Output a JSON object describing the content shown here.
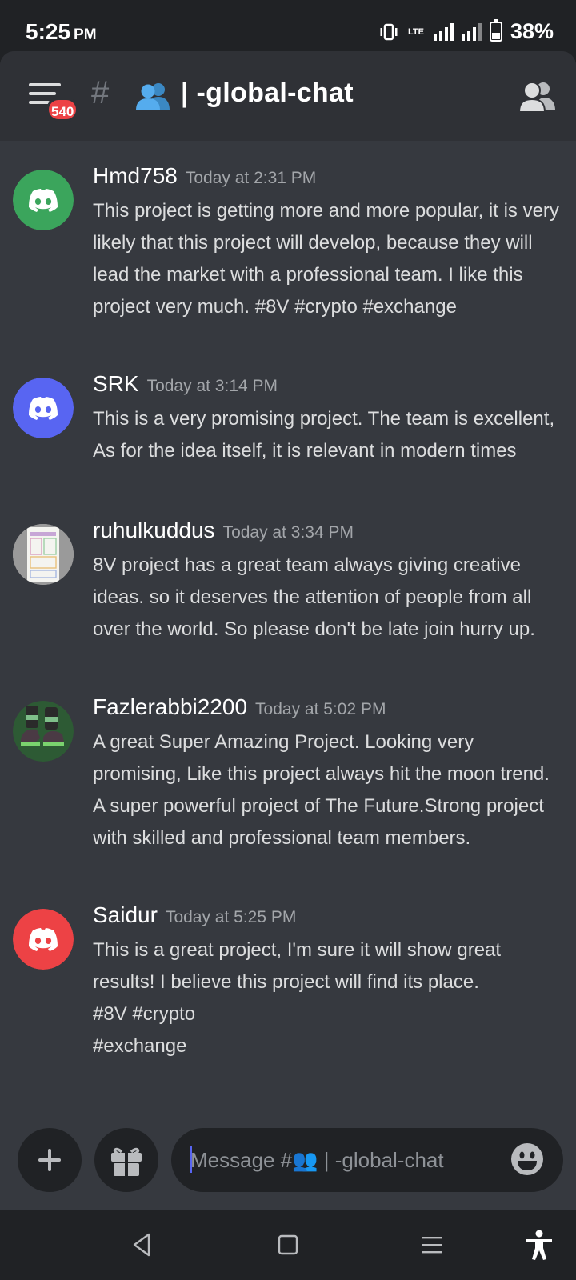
{
  "status_bar": {
    "time": "5:25",
    "ampm": "PM",
    "network": "LTE",
    "battery": "38%",
    "battery_level": 0.38
  },
  "header": {
    "unread_badge": "540",
    "channel_prefix": "#",
    "channel_emoji": "people-emoji",
    "channel_name": "| -global-chat"
  },
  "messages": [
    {
      "author": "Hmd758",
      "time": "Today at 2:31 PM",
      "avatar_color": "#3ba55c",
      "text": "This project is getting more and more popular, it is very likely that this project will develop, because they will lead the market with a professional team. I like this project very much. #8V #crypto #exchange"
    },
    {
      "author": "SRK",
      "time": "Today at 3:14 PM",
      "avatar_color": "#5865f2",
      "text": "This is a very promising project. The team is excellent, As for the idea itself, it is relevant in modern times"
    },
    {
      "author": "ruhulkuddus",
      "time": "Today at 3:34 PM",
      "avatar_color": "#9a9a9a",
      "text": "8V  project has a great team always giving creative ideas. so it deserves the attention of people from all over the world. So please don't be late join hurry up."
    },
    {
      "author": "Fazlerabbi2200",
      "time": "Today at 5:02 PM",
      "avatar_color": "#2d5a34",
      "text": "A great Super Amazing Project. Looking very promising, Like this project always hit the moon trend. A super powerful project of The Future.Strong project with skilled and professional team members."
    },
    {
      "author": "Saidur",
      "time": "Today at 5:25 PM",
      "avatar_color": "#ed4245",
      "text": "This is a great project, I'm sure it will show great results! I believe this project will find its place.\n#8V #crypto\n#exchange"
    }
  ],
  "composer": {
    "placeholder": "Message #👥 | -global-chat"
  },
  "colors": {
    "background": "#36393f",
    "header": "#2f3136",
    "input": "#202225",
    "accent": "#5865f2",
    "danger": "#ed4245"
  }
}
